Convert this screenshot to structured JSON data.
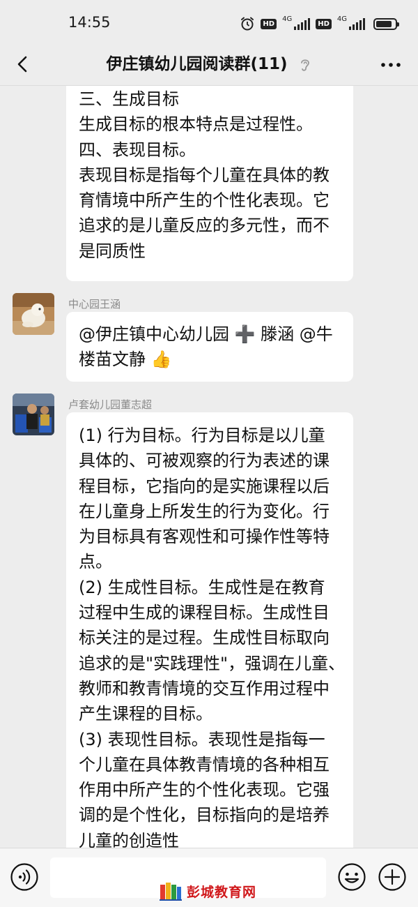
{
  "status_bar": {
    "time": "14:55",
    "hd_label": "HD",
    "network_label": "4G",
    "battery_level": 0.85
  },
  "header": {
    "back_icon": "chevron-left-icon",
    "title": "伊庄镇幼儿园阅读群(11)",
    "ear_icon": "ear-icon",
    "more_icon": "more-dots-icon"
  },
  "messages": [
    {
      "sender": "",
      "lines": [
        "三、生成目标",
        "生成目标的根本特点是过程性。",
        "四、表现目标。",
        "表现目标是指每个儿童在具体的教",
        "育情境中所产生的个性化表现。它",
        "追求的是儿童反应的多元性，而不",
        "是同质性"
      ]
    },
    {
      "sender": "中心园王涵",
      "lines": [
        "@伊庄镇中心幼儿园 ➕ 滕涵  @牛",
        "楼苗文静 👍"
      ]
    },
    {
      "sender": "卢套幼儿园董志超",
      "lines": [
        "(1) 行为目标。行为目标是以儿童",
        "具体的、可被观察的行为表述的课",
        "程目标，它指向的是实施课程以后",
        "在儿童身上所发生的行为变化。行",
        "为目标具有客观性和可操作性等特",
        "点。",
        "(2) 生成性目标。生成性是在教育",
        "过程中生成的课程目标。生成性目",
        "标关注的是过程。生成性目标取向",
        "追求的是\"实践理性\"，强调在儿童、",
        "教师和教青情境的交互作用过程中",
        "产生课程的目标。",
        "(3) 表现性目标。表现性是指每一",
        "个儿童在具体教青情境的各种相互",
        "作用中所产生的个性化表现。它强",
        "调的是个性化，目标指向的是培养",
        "儿童的创造性"
      ]
    }
  ],
  "input_bar": {
    "voice_icon": "voice-icon",
    "emoji_icon": "emoji-icon",
    "plus_icon": "plus-circle-icon"
  },
  "watermark": {
    "text": "彭城教育网",
    "icon": "books-logo-icon"
  }
}
